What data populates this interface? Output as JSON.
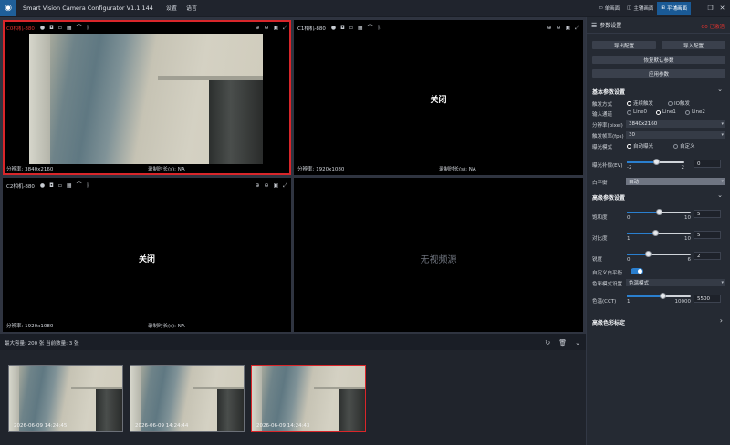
{
  "titlebar": {
    "app_title": "Smart Vision Camera Configurator V1.1.144",
    "menu": [
      "设置",
      "语言"
    ],
    "view_tabs": [
      {
        "label": "单画面",
        "active": false
      },
      {
        "label": "主辅画面",
        "active": false
      },
      {
        "label": "平铺画面",
        "active": true
      }
    ]
  },
  "cells": [
    {
      "name": "C0相机-880",
      "resolution": "分辨率: 3840x2160",
      "record": "录制时长(s): NA",
      "selected": true
    },
    {
      "name": "C1相机-880",
      "resolution": "分辨率: 1920x1080",
      "record": "录制时长(s): NA",
      "center": "关闭"
    },
    {
      "name": "C2相机-880",
      "resolution": "分辨率: 1920x1080",
      "record": "录制时长(s): NA",
      "center": "关闭"
    },
    {
      "center": "无视频源"
    }
  ],
  "history": {
    "summary": "最大容量: 200 张 当前数量: 3 张",
    "thumbs": [
      "2026-06-09 14:24:45",
      "2026-06-09 14:24:44",
      "2026-06-09 14:24:43"
    ]
  },
  "panel": {
    "title": "参数设置",
    "status": "C0 已激活",
    "buttons": {
      "export": "导出配置",
      "import": "导入配置",
      "restore": "恢复默认参数",
      "apply": "应用参数"
    },
    "basic": {
      "title": "基本参数设置",
      "trigger_label": "触发方式",
      "trigger_options": [
        "连续触发",
        "IO触发"
      ],
      "channel_label": "输入通道",
      "channel_options": [
        "Line0",
        "Line1",
        "Line2"
      ],
      "resolution_label": "分辨率(pixel)",
      "resolution_value": "3840x2160",
      "fps_label": "触发帧率(fps)",
      "fps_value": "30",
      "exposure_label": "曝光模式",
      "exposure_options": [
        "自动曝光",
        "自定义"
      ],
      "ev_label": "曝光补偿(EV)",
      "ev_min": "-2",
      "ev_max": "2",
      "ev_value": "0",
      "wb_label": "白平衡",
      "wb_value": "自动"
    },
    "advanced": {
      "title": "高级参数设置",
      "saturation_label": "饱和度",
      "saturation_min": "0",
      "saturation_max": "10",
      "saturation_value": "5",
      "contrast_label": "对比度",
      "contrast_min": "1",
      "contrast_max": "10",
      "contrast_value": "5",
      "sharpness_label": "锐度",
      "sharpness_min": "0",
      "sharpness_max": "6",
      "sharpness_value": "2",
      "custom_wb_label": "自定义白平衡",
      "color_mode_label": "色彩模式设置",
      "color_mode_value": "色温模式",
      "cct_label": "色温(CCT)",
      "cct_min": "1",
      "cct_max": "10000",
      "cct_value": "5500"
    },
    "calibration_title": "高级色彩标定"
  },
  "levels": {
    "ev": 0.5,
    "saturation": 0.5,
    "contrast": 0.44,
    "sharpness": 0.33,
    "cct": 0.55
  },
  "colors": {
    "accent": "#2a7fcf",
    "active_tab": "#1a5a96",
    "alert": "#e3332f"
  }
}
